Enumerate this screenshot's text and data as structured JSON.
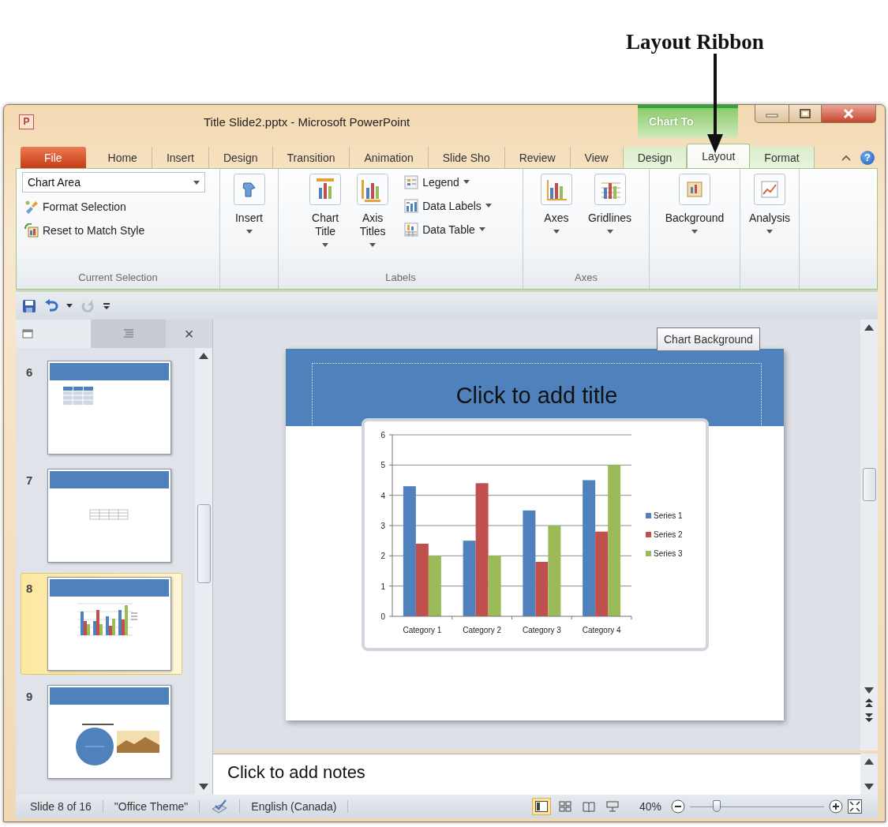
{
  "annotation": {
    "text": "Layout Ribbon"
  },
  "window": {
    "app_icon": "P",
    "title": "Title Slide2.pptx - Microsoft PowerPoint",
    "context_tab": "Chart To"
  },
  "tabs": [
    {
      "label": "File",
      "kind": "file",
      "selected": false
    },
    {
      "label": "Home",
      "kind": "core",
      "selected": false
    },
    {
      "label": "Insert",
      "kind": "core",
      "selected": false
    },
    {
      "label": "Design",
      "kind": "core",
      "selected": false
    },
    {
      "label": "Transition",
      "kind": "core",
      "selected": false
    },
    {
      "label": "Animation",
      "kind": "core",
      "selected": false
    },
    {
      "label": "Slide Sho",
      "kind": "core",
      "selected": false
    },
    {
      "label": "Review",
      "kind": "core",
      "selected": false
    },
    {
      "label": "View",
      "kind": "core",
      "selected": false
    },
    {
      "label": "Design",
      "kind": "context",
      "selected": false
    },
    {
      "label": "Layout",
      "kind": "context",
      "selected": true
    },
    {
      "label": "Format",
      "kind": "context",
      "selected": false
    }
  ],
  "help": "?",
  "ribbon": {
    "groups": [
      {
        "label": "Current Selection",
        "items": [
          {
            "kind": "dropdown",
            "value": "Chart Area"
          },
          {
            "kind": "small",
            "label": "Format Selection",
            "dropdown": false
          },
          {
            "kind": "small",
            "label": "Reset to Match Style",
            "dropdown": false
          }
        ]
      },
      {
        "items": [
          {
            "kind": "large",
            "label": "Insert",
            "dropdown": true
          }
        ]
      },
      {
        "label": "Labels",
        "items": [
          {
            "kind": "large",
            "label": "Chart Title",
            "dropdown": true
          },
          {
            "kind": "large",
            "label": "Axis Titles",
            "dropdown": true
          },
          {
            "kind": "small",
            "label": "Legend",
            "dropdown": true
          },
          {
            "kind": "small",
            "label": "Data Labels",
            "dropdown": true
          },
          {
            "kind": "small",
            "label": "Data Table",
            "dropdown": true
          }
        ]
      },
      {
        "label": "Axes",
        "items": [
          {
            "kind": "large",
            "label": "Axes",
            "dropdown": true
          },
          {
            "kind": "large",
            "label": "Gridlines",
            "dropdown": true
          }
        ]
      },
      {
        "items": [
          {
            "kind": "large",
            "label": "Background",
            "dropdown": true
          }
        ]
      },
      {
        "items": [
          {
            "kind": "large",
            "label": "Analysis",
            "dropdown": true
          }
        ]
      }
    ]
  },
  "quick_access": [
    {
      "kind": "save",
      "disabled": false
    },
    {
      "kind": "undo",
      "disabled": false
    },
    {
      "kind": "menu",
      "disabled": false
    },
    {
      "kind": "redo",
      "disabled": true
    },
    {
      "kind": "customize",
      "disabled": false
    }
  ],
  "slides_pane": {
    "tabs": [
      {
        "kind": "slides",
        "selected": true
      },
      {
        "kind": "outline",
        "selected": false
      }
    ],
    "close": "×",
    "thumbnails": [
      {
        "number": "6",
        "kind": "table",
        "selected": false
      },
      {
        "number": "7",
        "kind": "grid",
        "selected": false
      },
      {
        "number": "8",
        "kind": "chart",
        "selected": true
      },
      {
        "number": "9",
        "kind": "picture",
        "selected": false
      }
    ]
  },
  "tooltip": "Chart Background",
  "slide": {
    "title_placeholder": "Click to add title",
    "chart": {
      "chart_data": {
        "type": "bar",
        "categories": [
          "Category 1",
          "Category 2",
          "Category 3",
          "Category 4"
        ],
        "series": [
          {
            "name": "Series 1",
            "color": "#4f81bd",
            "values": [
              4.3,
              2.5,
              3.5,
              4.5
            ]
          },
          {
            "name": "Series 2",
            "color": "#c0504d",
            "values": [
              2.4,
              4.4,
              1.8,
              2.8
            ]
          },
          {
            "name": "Series 3",
            "color": "#9bbb59",
            "values": [
              2,
              2,
              3,
              5
            ]
          }
        ],
        "ylim": [
          0,
          6
        ],
        "yticks": [
          0,
          1,
          2,
          3,
          4,
          5,
          6
        ],
        "grid": true,
        "legend": true
      }
    }
  },
  "notes_placeholder": "Click to add notes",
  "status_bar": {
    "items": [
      {
        "kind": "text",
        "text": "Slide 8 of 16"
      },
      {
        "kind": "text",
        "text": "\"Office Theme\""
      },
      {
        "kind": "spelling"
      },
      {
        "kind": "text",
        "text": "English (Canada)"
      }
    ],
    "views": [
      {
        "kind": "normal",
        "selected": true
      },
      {
        "kind": "sorter",
        "selected": false
      },
      {
        "kind": "reading",
        "selected": false
      },
      {
        "kind": "slideshow",
        "selected": false
      }
    ],
    "zoom": {
      "text": "40%",
      "level": 0.2
    }
  }
}
